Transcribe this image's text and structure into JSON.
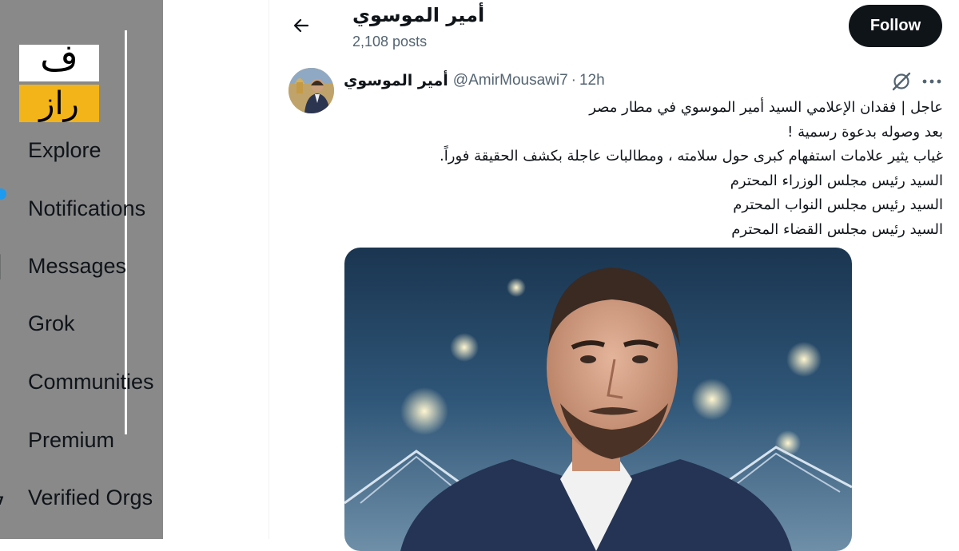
{
  "sidebar": {
    "items": [
      {
        "label": "Explore"
      },
      {
        "label": "Notifications"
      },
      {
        "label": "Messages"
      },
      {
        "label": "Grok"
      },
      {
        "label": "Communities"
      },
      {
        "label": "Premium"
      },
      {
        "label": "Verified Orgs"
      }
    ]
  },
  "logo": {
    "top_glyph": "ف",
    "bottom_text": "راز"
  },
  "header": {
    "name": "أمير الموسوي",
    "posts_count": "2,108 posts",
    "follow_label": "Follow"
  },
  "tweet": {
    "author_name": "أمير الموسوي",
    "handle": "@AmirMousawi7",
    "separator": "·",
    "time": "12h",
    "lines": [
      "عاجل | فقدان الإعلامي  السيد أمير الموسوي في مطار مصر",
      "بعد وصوله بدعوة رسمية !",
      "غياب يثير علامات استفهام كبرى حول سلامته ، ومطالبات عاجلة بكشف الحقيقة فوراً.",
      "السيد رئيس مجلس الوزراء المحترم",
      "السيد رئيس مجلس النواب المحترم",
      "السيد رئيس مجلس القضاء المحترم"
    ]
  },
  "icons": {
    "back": "arrow-left-icon",
    "grok": "grok-icon",
    "more": "more-icon"
  },
  "colors": {
    "sidebar_bg": "#898989",
    "follow_bg": "#0f1419",
    "muted_text": "#536471",
    "accent_blue": "#1d9bf0",
    "logo_yellow": "#f2b418"
  }
}
